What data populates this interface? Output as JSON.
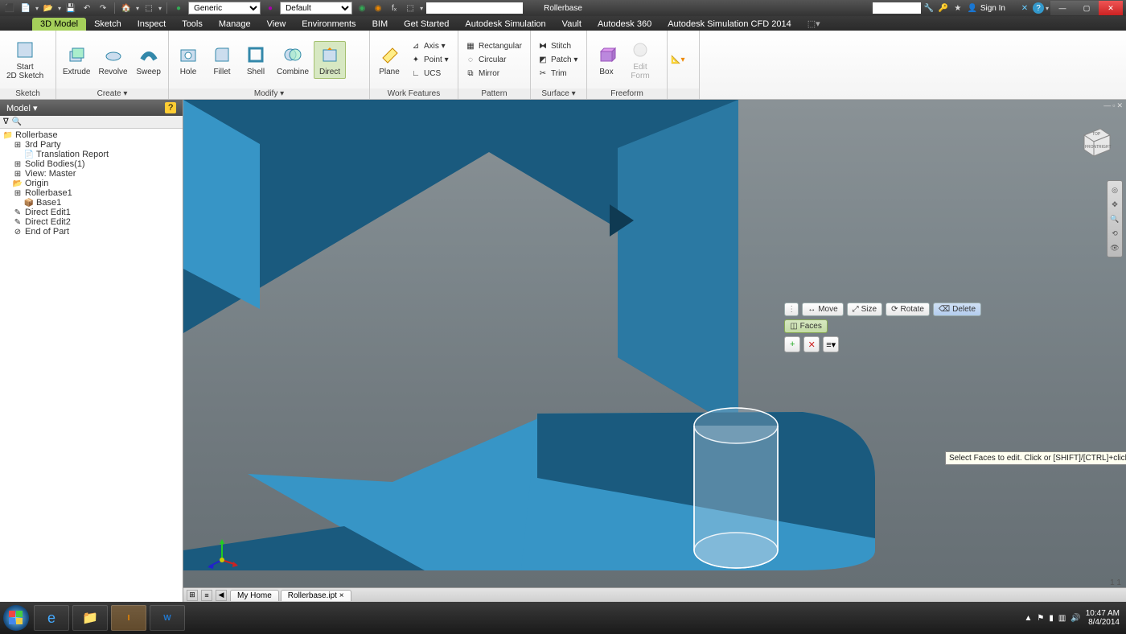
{
  "title": "Rollerbase",
  "combos": {
    "material": "Generic",
    "appearance": "Default"
  },
  "signin": "Sign In",
  "ribbon_tabs": [
    "3D Model",
    "Sketch",
    "Inspect",
    "Tools",
    "Manage",
    "View",
    "Environments",
    "BIM",
    "Get Started",
    "Autodesk Simulation",
    "Vault",
    "Autodesk 360",
    "Autodesk Simulation CFD 2014"
  ],
  "ribbon": {
    "sketch": {
      "start": "Start\n2D Sketch",
      "title": "Sketch"
    },
    "create": {
      "extrude": "Extrude",
      "revolve": "Revolve",
      "sweep": "Sweep",
      "title": "Create ▾"
    },
    "modify": {
      "hole": "Hole",
      "fillet": "Fillet",
      "shell": "Shell",
      "combine": "Combine",
      "direct": "Direct",
      "title": "Modify ▾"
    },
    "workfeat": {
      "plane": "Plane",
      "axis": "Axis ▾",
      "point": "Point ▾",
      "ucs": "UCS",
      "title": "Work Features"
    },
    "pattern": {
      "rect": "Rectangular",
      "circ": "Circular",
      "mirror": "Mirror",
      "title": "Pattern"
    },
    "surface": {
      "stitch": "Stitch",
      "patch": "Patch ▾",
      "trim": "Trim",
      "title": "Surface ▾"
    },
    "freeform": {
      "box": "Box",
      "edit": "Edit\nForm",
      "title": "Freeform"
    }
  },
  "model_panel": {
    "header": "Model ▾",
    "tree": [
      {
        "lvl": 0,
        "ico": "📁",
        "txt": "Rollerbase"
      },
      {
        "lvl": 1,
        "ico": "⊞",
        "txt": "3rd Party"
      },
      {
        "lvl": 2,
        "ico": "📄",
        "txt": "Translation Report"
      },
      {
        "lvl": 1,
        "ico": "⊞",
        "txt": "Solid Bodies(1)"
      },
      {
        "lvl": 1,
        "ico": "⊞",
        "txt": "View: Master"
      },
      {
        "lvl": 1,
        "ico": "📂",
        "txt": "Origin"
      },
      {
        "lvl": 1,
        "ico": "⊞",
        "txt": "Rollerbase1"
      },
      {
        "lvl": 2,
        "ico": "📦",
        "txt": "Base1"
      },
      {
        "lvl": 1,
        "ico": "✎",
        "txt": "Direct Edit1"
      },
      {
        "lvl": 1,
        "ico": "✎",
        "txt": "Direct Edit2"
      },
      {
        "lvl": 1,
        "ico": "⊘",
        "txt": "End of Part"
      }
    ]
  },
  "mini": {
    "move": "Move",
    "size": "Size",
    "rotate": "Rotate",
    "delete": "Delete",
    "faces": "Faces"
  },
  "tooltip": "Select Faces to edit. Click or [SHIFT]/[CTRL]+click to add; [SHIFT]/[CTRL]+click to deselect",
  "doc_tabs": {
    "home": "My Home",
    "file": "Rollerbase.ipt ×"
  },
  "status": {
    "coords": "1     1"
  },
  "clock": {
    "time": "10:47 AM",
    "date": "8/4/2014"
  }
}
